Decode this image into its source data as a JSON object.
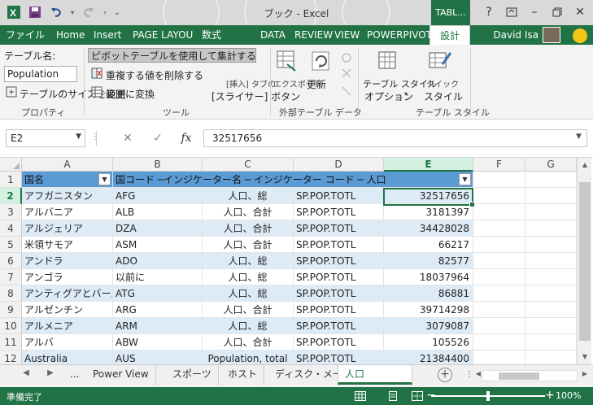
{
  "window": {
    "title": "ブック - Excel",
    "context_tab": "TABL...",
    "user": "David Isa"
  },
  "ribbon_tabs": [
    "ファイル",
    "Home",
    "Insert",
    "PAGE LAYOU",
    "数式",
    "DATA",
    "REVIEW",
    "VIEW",
    "POWERPIVOT",
    "設計"
  ],
  "ribbon": {
    "table_name_label": "テーブル名:",
    "table_name_value": "Population",
    "resize_table": "テーブルのサイズを変更",
    "properties_group": "プロパティ",
    "summarize_pivot": "ピボットテーブルを使用して集計する →",
    "remove_duplicates": "重複する値を削除する",
    "convert_to_range": "範囲に変換",
    "insert_slicer_1": "[挿入] タブの",
    "insert_slicer_2": "[スライサー] ボタン",
    "tools_group": "ツール",
    "export": "エクスポート",
    "refresh": "更新",
    "external_group": "外部テーブル データ",
    "table_style_options_1": "テーブル スタイル",
    "table_style_options_2": "オプション",
    "quick_styles_1": "クイック",
    "quick_styles_2": "スタイル",
    "table_styles_group": "テーブル スタイル"
  },
  "formula_bar": {
    "name_box": "E2",
    "cancel": "✕",
    "enter": "✓",
    "fx": "fx",
    "formula": "32517656"
  },
  "grid": {
    "columns": [
      "A",
      "B",
      "C",
      "D",
      "E",
      "F",
      "G"
    ],
    "selected_column": "E",
    "selected_row": "2",
    "row_numbers": [
      "1",
      "2",
      "3",
      "4",
      "5",
      "6",
      "7",
      "8",
      "9",
      "10",
      "11",
      "12"
    ],
    "header": {
      "a": "国名",
      "b": "国コード ─インジケーター名 ─ インジケーター コード ─ 人口"
    },
    "rows": [
      {
        "country": "アフガニスタン",
        "code": "AFG",
        "indicator": "人口、総",
        "indicator_code": "SP.POP.TOTL",
        "population": "32517656"
      },
      {
        "country": "アルバニア",
        "code": "ALB",
        "indicator": "人口、合計",
        "indicator_code": "SP.POP.TOTL",
        "population": "3181397"
      },
      {
        "country": "アルジェリア",
        "code": "DZA",
        "indicator": "人口、合計",
        "indicator_code": "SP.POP.TOTL",
        "population": "34428028"
      },
      {
        "country": "米領サモア",
        "code": "ASM",
        "indicator": "人口、合計",
        "indicator_code": "SP.POP.TOTL",
        "population": "66217"
      },
      {
        "country": "アンドラ",
        "code": "ADO",
        "indicator": "人口、総",
        "indicator_code": "SP.POP.TOTL",
        "population": "82577"
      },
      {
        "country": "アンゴラ",
        "code": "以前に",
        "indicator": "人口、総",
        "indicator_code": "SP.POP.TOTL",
        "population": "18037964"
      },
      {
        "country": "アンティグアとバーバ",
        "code": "ATG",
        "indicator": "人口、総",
        "indicator_code": "SP.POP.TOTL",
        "population": "86881"
      },
      {
        "country": "アルゼンチン",
        "code": "ARG",
        "indicator": "人口、合計",
        "indicator_code": "SP.POP.TOTL",
        "population": "39714298"
      },
      {
        "country": "アルメニア",
        "code": "ARM",
        "indicator": "人口、総",
        "indicator_code": "SP.POP.TOTL",
        "population": "3079087"
      },
      {
        "country": "アルバ",
        "code": "ABW",
        "indicator": "人口、合計",
        "indicator_code": "SP.POP.TOTL",
        "population": "105526"
      },
      {
        "country": "Australia",
        "code": "AUS",
        "indicator": "Population, total",
        "indicator_code": "SP.POP.TOTL",
        "population": "21384400"
      }
    ]
  },
  "sheets": {
    "more": "...",
    "tabs": [
      "Power View",
      "スポーツ",
      "ホスト",
      "ディスク・メージ",
      "人口"
    ],
    "active": "人口"
  },
  "status": {
    "ready": "準備完了",
    "zoom": "100%"
  },
  "colors": {
    "accent": "#217346",
    "table_header": "#5b9bd5",
    "table_band": "#ddebf7"
  }
}
